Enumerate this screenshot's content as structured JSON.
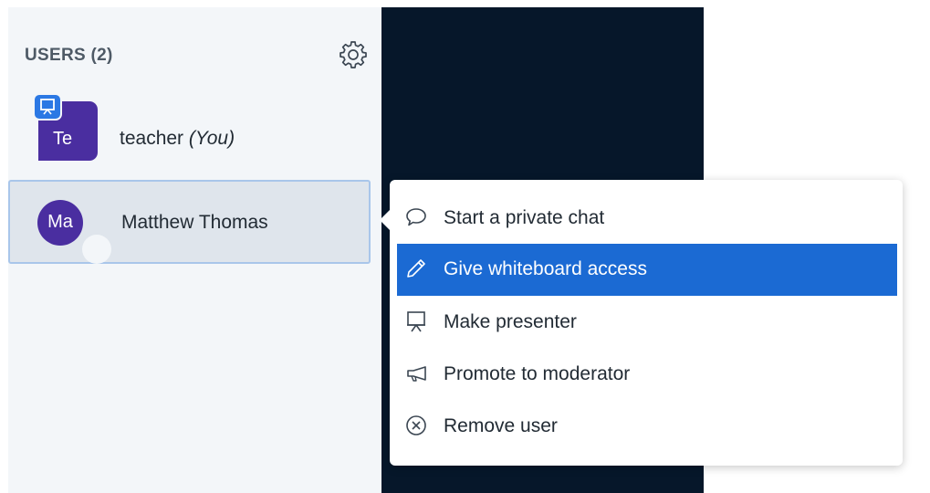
{
  "users_panel": {
    "title": "USERS (2)",
    "settings_icon": "gear-icon",
    "users": [
      {
        "initials": "Te",
        "name": "teacher",
        "you_tag": "(You)",
        "is_presenter": true,
        "avatar_color": "#4a2ea0"
      },
      {
        "initials": "Ma",
        "name": "Matthew Thomas",
        "selected": true,
        "avatar_color": "#4a2ea0"
      }
    ]
  },
  "context_menu": {
    "items": [
      {
        "label": "Start a private chat",
        "icon": "chat-bubble-icon"
      },
      {
        "label": "Give whiteboard access",
        "icon": "pencil-icon",
        "highlighted": true
      },
      {
        "label": "Make presenter",
        "icon": "presentation-screen-icon"
      },
      {
        "label": "Promote to moderator",
        "icon": "megaphone-icon"
      },
      {
        "label": "Remove user",
        "icon": "close-circle-icon"
      }
    ]
  },
  "colors": {
    "panel_bg": "#f3f6f9",
    "presentation_bg": "#06172a",
    "highlight": "#1b6ad3",
    "avatar": "#4a2ea0",
    "presenter_badge": "#2b78e4"
  }
}
